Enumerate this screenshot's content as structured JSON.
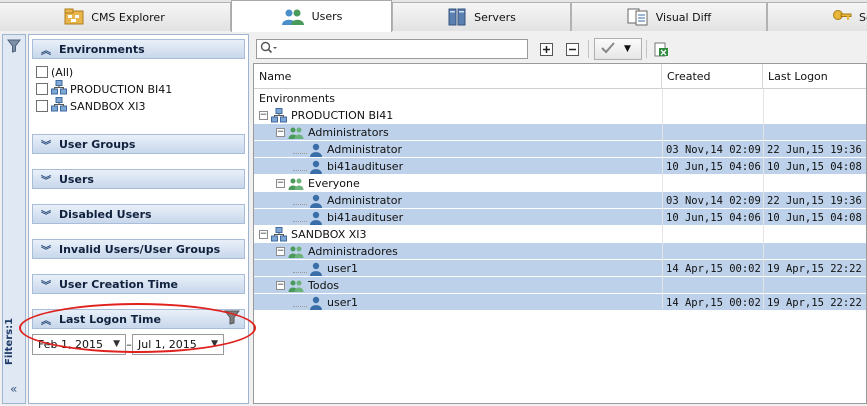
{
  "tabs": [
    {
      "label": "CMS Explorer",
      "icon": "cms-explorer-icon"
    },
    {
      "label": "Users",
      "icon": "users-icon"
    },
    {
      "label": "Servers",
      "icon": "servers-icon"
    },
    {
      "label": "Visual Diff",
      "icon": "visual-diff-icon"
    },
    {
      "label": "Se",
      "icon": "security-key-icon"
    }
  ],
  "filters_label": "Filters:1",
  "filter_panel": {
    "environments": {
      "title": "Environments",
      "items": [
        {
          "label": "(All)",
          "checked": false
        },
        {
          "label": "PRODUCTION BI41",
          "checked": false
        },
        {
          "label": "SANDBOX XI3",
          "checked": false
        }
      ]
    },
    "sections": [
      {
        "label": "User Groups"
      },
      {
        "label": "Users"
      },
      {
        "label": "Disabled Users"
      },
      {
        "label": "Invalid Users/User Groups"
      },
      {
        "label": "User Creation Time"
      }
    ],
    "last_logon": {
      "title": "Last Logon Time",
      "from": "Feb 1, 2015",
      "separator": "–",
      "to": "Jul 1, 2015"
    }
  },
  "grid": {
    "columns": [
      "Name",
      "Created",
      "Last Logon"
    ],
    "rows": [
      {
        "name": "Environments",
        "level": 0,
        "icon": "",
        "toggle": "",
        "created": "",
        "last": "",
        "sel": false
      },
      {
        "name": "PRODUCTION BI41",
        "level": 0,
        "icon": "server",
        "toggle": "⊟",
        "created": "",
        "last": "",
        "sel": false
      },
      {
        "name": "Administrators",
        "level": 1,
        "icon": "group",
        "toggle": "⊟",
        "created": "",
        "last": "",
        "sel": true
      },
      {
        "name": "Administrator",
        "level": 2,
        "icon": "user",
        "toggle": "",
        "created": "03 Nov,14 02:09",
        "last": "22 Jun,15 19:36",
        "sel": true
      },
      {
        "name": "bi41audituser",
        "level": 2,
        "icon": "user",
        "toggle": "",
        "created": "10 Jun,15 04:06",
        "last": "10 Jun,15 04:08",
        "sel": true
      },
      {
        "name": "Everyone",
        "level": 1,
        "icon": "group",
        "toggle": "⊟",
        "created": "",
        "last": "",
        "sel": false
      },
      {
        "name": "Administrator",
        "level": 2,
        "icon": "user",
        "toggle": "",
        "created": "03 Nov,14 02:09",
        "last": "22 Jun,15 19:36",
        "sel": true
      },
      {
        "name": "bi41audituser",
        "level": 2,
        "icon": "user",
        "toggle": "",
        "created": "10 Jun,15 04:06",
        "last": "10 Jun,15 04:08",
        "sel": true
      },
      {
        "name": "SANDBOX XI3",
        "level": 0,
        "icon": "server",
        "toggle": "⊟",
        "created": "",
        "last": "",
        "sel": false
      },
      {
        "name": "Administradores",
        "level": 1,
        "icon": "group",
        "toggle": "⊟",
        "created": "",
        "last": "",
        "sel": true
      },
      {
        "name": "user1",
        "level": 2,
        "icon": "user",
        "toggle": "",
        "created": "14 Apr,15 00:02",
        "last": "19 Apr,15 22:22",
        "sel": true
      },
      {
        "name": "Todos",
        "level": 1,
        "icon": "group",
        "toggle": "⊟",
        "created": "",
        "last": "",
        "sel": true
      },
      {
        "name": "user1",
        "level": 2,
        "icon": "user",
        "toggle": "",
        "created": "14 Apr,15 00:02",
        "last": "19 Apr,15 22:22",
        "sel": true
      }
    ]
  },
  "colors": {
    "selection": "#bdd2ea",
    "section_header": "#c8d7ec",
    "highlight_ring": "#e0221f",
    "user_icon": "#3a6ea8",
    "group_icon": "#4a9a5b"
  }
}
